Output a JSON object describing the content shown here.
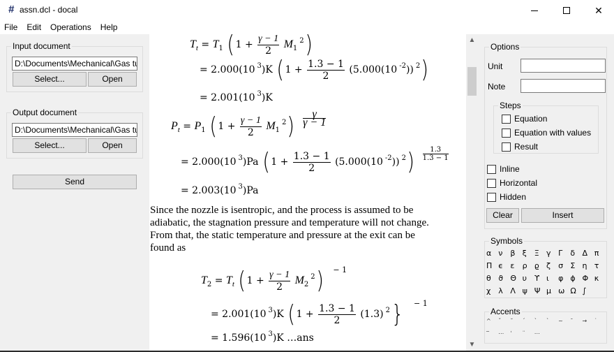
{
  "window": {
    "title": "assn.dcl - docal",
    "app_icon": "#",
    "controls": {
      "minimize": "minimize-icon",
      "maximize": "maximize-icon",
      "close": "✕"
    }
  },
  "menu": [
    "File",
    "Edit",
    "Operations",
    "Help"
  ],
  "left_panel": {
    "input_group": {
      "legend": "Input document",
      "path_value": "D:\\Documents\\Mechanical\\Gas tu",
      "select_label": "Select...",
      "open_label": "Open"
    },
    "output_group": {
      "legend": "Output document",
      "path_value": "D:\\Documents\\Mechanical\\Gas tu",
      "select_label": "Select...",
      "open_label": "Open"
    },
    "send_label": "Send"
  },
  "document": {
    "eq1": {
      "lhs": "T",
      "lhs_sub": "t",
      "line1_rhs_var": "T",
      "line1_rhs_sub": "1",
      "one": "1 +",
      "frac_num": "γ − 1",
      "frac_den": "2",
      "mach": "M",
      "mach_sub": "1",
      "sq": "2",
      "line2_prefix": "= 2.000(10",
      "line2_exp": "3",
      "line2_unit": ")K",
      "line2_frac_num": "1.3 − 1",
      "line2_frac_den": "2",
      "line2_val": "(5.000(10",
      "line2_val_exp": "-2",
      "line2_val_close": "))",
      "line3_prefix": "= 2.001(10",
      "line3_exp": "3",
      "line3_unit": ")K"
    },
    "eq2": {
      "lhs": "P",
      "lhs_sub": "t",
      "line1_rhs_var": "P",
      "line1_rhs_sub": "1",
      "one": "1 +",
      "frac_num": "γ − 1",
      "frac_den": "2",
      "mach": "M",
      "mach_sub": "1",
      "sq": "2",
      "exp_num": "γ",
      "exp_den": "γ − 1",
      "line2_prefix": "= 2.000(10",
      "line2_exp": "3",
      "line2_unit": ")Pa",
      "line2_frac_num": "1.3 − 1",
      "line2_frac_den": "2",
      "line2_val": "(5.000(10",
      "line2_val_exp": "-2",
      "line2_val_close": "))",
      "line2_exp_num": "1.3",
      "line2_exp_den": "1.3 − 1",
      "line3_prefix": "= 2.003(10",
      "line3_exp": "3",
      "line3_unit": ")Pa"
    },
    "paragraph": "Since the nozzle is isentropic, and the process is assumed to be adiabatic, the stagnation pressure and temperature will not change. From that, the static temperature and pressure at the exit can be found as",
    "eq3": {
      "lhs": "T",
      "lhs_sub": "2",
      "line1_rhs_var": "T",
      "line1_rhs_sub": "t",
      "one": "1 +",
      "frac_num": "γ − 1",
      "frac_den": "2",
      "mach": "M",
      "mach_sub": "2",
      "sq": "2",
      "power": "− 1",
      "line2_prefix": "= 2.001(10",
      "line2_exp": "3",
      "line2_unit": ")K",
      "line2_frac_num": "1.3 − 1",
      "line2_frac_den": "2",
      "line2_val": "(1.3)",
      "line3_prefix": "= 1.596(10",
      "line3_exp": "3",
      "line3_unit": ")K …ans"
    }
  },
  "scrollbar": {
    "up": "▲",
    "down": "▼",
    "position_fraction": 0.08
  },
  "options": {
    "legend": "Options",
    "unit_label": "Unit",
    "unit_value": "",
    "note_label": "Note",
    "note_value": "",
    "steps": {
      "legend": "Steps",
      "items": [
        {
          "label": "Equation",
          "checked": false
        },
        {
          "label": "Equation with values",
          "checked": false
        },
        {
          "label": "Result",
          "checked": false
        }
      ]
    },
    "flags": [
      {
        "label": "Inline",
        "checked": false
      },
      {
        "label": "Horizontal",
        "checked": false
      },
      {
        "label": "Hidden",
        "checked": false
      }
    ],
    "clear_label": "Clear",
    "insert_label": "Insert"
  },
  "symbols": {
    "legend": "Symbols",
    "items": [
      "α",
      "ν",
      "β",
      "ξ",
      "Ξ",
      "γ",
      "Γ",
      "δ",
      "Δ",
      "π",
      "Π",
      "ϵ",
      "ε",
      "ρ",
      "ϱ",
      "ζ",
      "σ",
      "Σ",
      "η",
      "τ",
      "θ",
      "ϑ",
      "Θ",
      "υ",
      "ϒ",
      "ι",
      "φ",
      "ϕ",
      "Φ",
      "κ",
      "χ",
      "λ",
      "Λ",
      "ψ",
      "Ψ",
      "μ",
      "ω",
      "Ω",
      "∫"
    ]
  },
  "accents": {
    "legend": "Accents",
    "items": [
      "^",
      "ˇ",
      "˘",
      "ˊ",
      "ˋ",
      "ˋ",
      "~",
      "¯",
      "→",
      "˙",
      "‾",
      "⋯",
      "ˈ",
      "¨",
      "⋯"
    ]
  }
}
